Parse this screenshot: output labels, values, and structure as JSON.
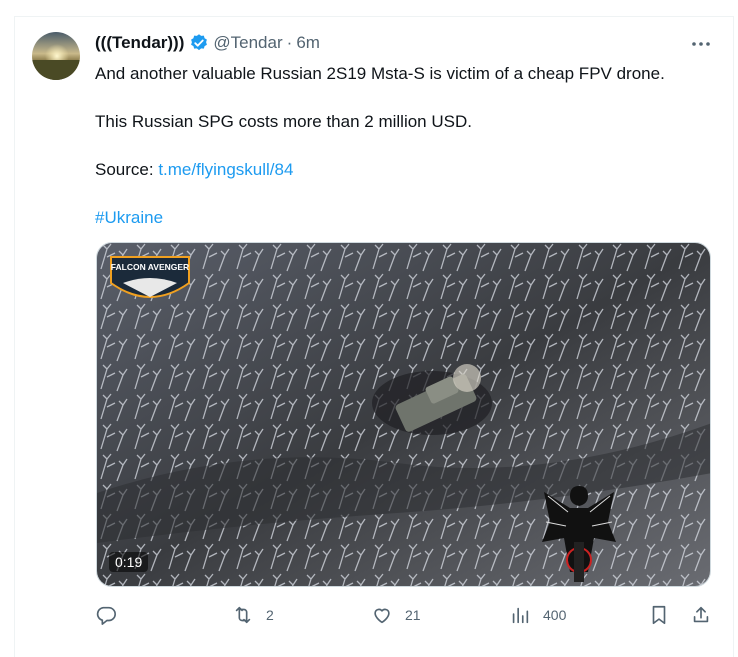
{
  "tweet": {
    "author_name": "(((Tendar)))",
    "handle": "@Tendar",
    "separator": "·",
    "time": "6m",
    "text_lines": [
      "And another valuable Russian 2S19 Msta-S is victim of a cheap FPV drone.",
      "This Russian SPG costs more than 2 million USD."
    ],
    "source_label": "Source: ",
    "source_link": "t.me/flyingskull/84",
    "hashtag": "#Ukraine"
  },
  "media": {
    "overlay_badge_text": "FALCON AVENGER",
    "timer": "0:19"
  },
  "actions": {
    "reply_icon": "reply-icon",
    "repost_icon": "repost-icon",
    "repost_count": "2",
    "like_icon": "heart-icon",
    "like_count": "21",
    "views_icon": "views-icon",
    "views_count": "400",
    "bookmark_icon": "bookmark-icon",
    "share_icon": "share-icon"
  },
  "colors": {
    "accent": "#1d9bf0",
    "secondary_text": "#536471"
  }
}
